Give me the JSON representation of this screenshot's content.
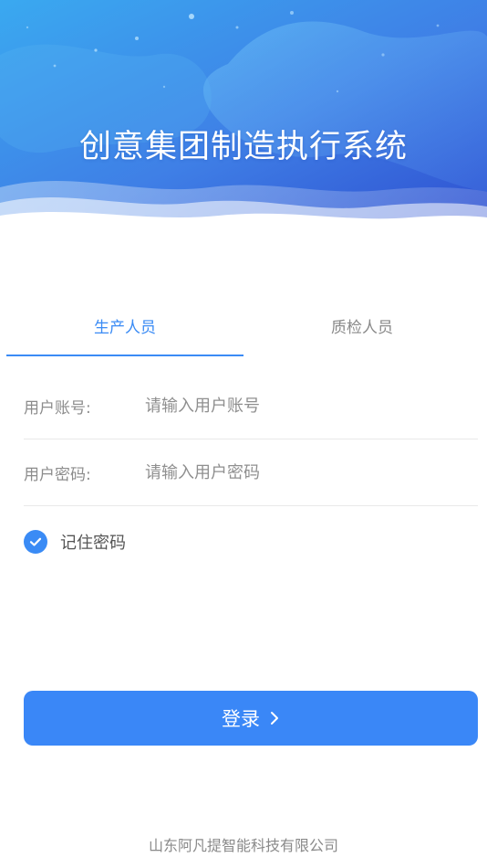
{
  "header": {
    "title": "创意集团制造执行系统"
  },
  "tabs": [
    {
      "label": "生产人员",
      "active": true
    },
    {
      "label": "质检人员",
      "active": false
    }
  ],
  "form": {
    "account": {
      "label": "用户账号:",
      "placeholder": "请输入用户账号",
      "value": ""
    },
    "password": {
      "label": "用户密码:",
      "placeholder": "请输入用户密码",
      "value": ""
    },
    "remember": {
      "label": "记住密码",
      "checked": true
    }
  },
  "login": {
    "label": "登录"
  },
  "footer": {
    "company": "山东阿凡提智能科技有限公司"
  },
  "icons": {
    "checkbox": "check-icon",
    "login_arrow": "chevron-right-icon"
  },
  "colors": {
    "accent": "#3a8bf5",
    "button": "#3a87f7",
    "banner_dark": "#2f5fd8",
    "banner_light": "#4aa8f0"
  }
}
